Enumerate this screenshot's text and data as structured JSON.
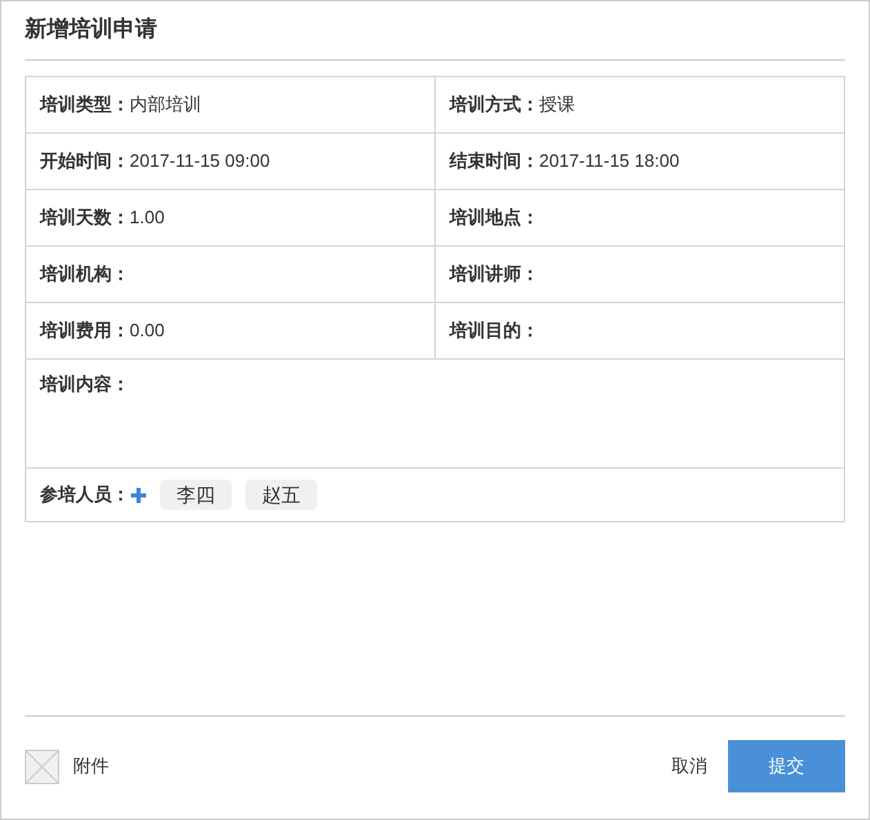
{
  "title": "新增培训申请",
  "rows": [
    [
      {
        "label": "培训类型：",
        "value": "内部培训"
      },
      {
        "label": "培训方式：",
        "value": "授课"
      }
    ],
    [
      {
        "label": "开始时间：",
        "value": "2017-11-15 09:00"
      },
      {
        "label": "结束时间：",
        "value": "2017-11-15 18:00"
      }
    ],
    [
      {
        "label": "培训天数：",
        "value": "1.00"
      },
      {
        "label": "培训地点："
      }
    ],
    [
      {
        "label": "培训机构："
      },
      {
        "label": "培训讲师："
      }
    ],
    [
      {
        "label": "培训费用：",
        "value": "0.00"
      },
      {
        "label": "培训目的："
      }
    ]
  ],
  "content": {
    "label": "培训内容："
  },
  "attendees": {
    "label": "参培人员：",
    "people": [
      "李四",
      "赵五"
    ]
  },
  "attachment": {
    "label": "附件"
  },
  "buttons": {
    "cancel": "取消",
    "submit": "提交"
  }
}
